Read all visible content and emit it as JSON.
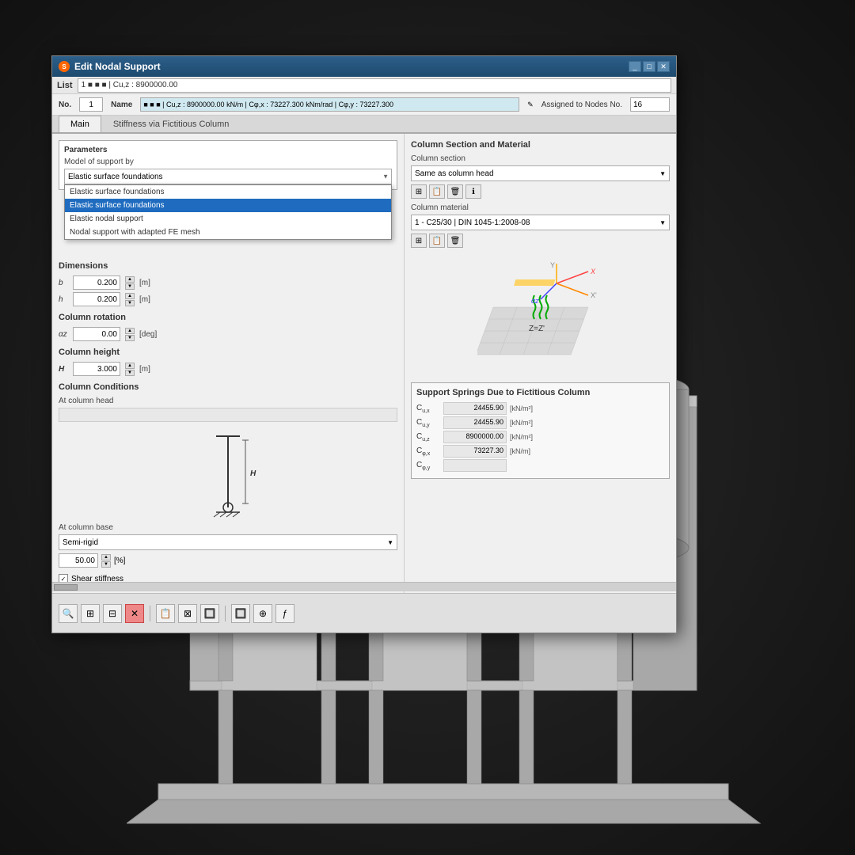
{
  "window": {
    "title": "Edit Nodal Support",
    "list_label": "List",
    "list_item": "1  ■ ■ ■ | Cu,z : 8900000.00",
    "no_label": "No.",
    "no_value": "1",
    "name_label": "Name",
    "name_value": "■ ■ ■ | Cu,z : 8900000.00 kN/m | Cφ,x : 73227.300 kNm/rad | Cφ,y : 73227.300",
    "assigned_label": "Assigned to Nodes No.",
    "assigned_value": "16"
  },
  "tabs": {
    "main_label": "Main",
    "stiffness_label": "Stiffness via Fictitious Column"
  },
  "params": {
    "section_label": "Parameters",
    "model_label": "Model of support by",
    "model_value": "Elastic surface foundations",
    "model_options": [
      "Elastic surface foundations",
      "Elastic surface foundations",
      "Elastic nodal support",
      "Nodal support with adapted FE mesh"
    ],
    "model_selected_index": 1
  },
  "dimensions": {
    "label": "Dimensions",
    "b_label": "b",
    "b_value": "0.200",
    "b_unit": "[m]",
    "h_label": "h",
    "h_value": "0.200",
    "h_unit": "[m]"
  },
  "col_rotation": {
    "label": "Column rotation",
    "az_label": "αz",
    "az_value": "0.00",
    "az_unit": "[deg]"
  },
  "col_height": {
    "label": "Column height",
    "H_label": "H",
    "H_value": "3.000",
    "H_unit": "[m]"
  },
  "col_conditions": {
    "label": "Column Conditions",
    "at_head_label": "At column head",
    "at_head_value": ""
  },
  "col_base": {
    "label": "At column base",
    "base_value": "Semi-rigid",
    "percent_value": "50.00",
    "percent_unit": "[%]"
  },
  "shear_stiffness": {
    "label": "Shear stiffness",
    "checked": true
  },
  "col_section": {
    "label": "Column Section and Material",
    "section_label": "Column section",
    "section_value": "Same as column head",
    "material_label": "Column material",
    "material_value": "1 - C25/30 | DIN 1045-1:2008-08"
  },
  "support_springs": {
    "label": "Support Springs Due to Fictitious Column",
    "rows": [
      {
        "label": "Cu,x",
        "value": "24455.90",
        "unit": "[kN/m²]"
      },
      {
        "label": "Cu,y",
        "value": "24455.90",
        "unit": "[kN/m²]"
      },
      {
        "label": "Cu,z",
        "value": "8900000.00",
        "unit": "[kN/m²]"
      },
      {
        "label": "Cφ,x",
        "value": "73227.30",
        "unit": "[kN/m]"
      },
      {
        "label": "Cφ,y",
        "value": "",
        "unit": ""
      }
    ]
  },
  "toolbar": {
    "icons": [
      "🔍",
      "⊞",
      "⊠",
      "✕",
      "📋",
      "🔄",
      "⚡",
      "☑"
    ]
  }
}
